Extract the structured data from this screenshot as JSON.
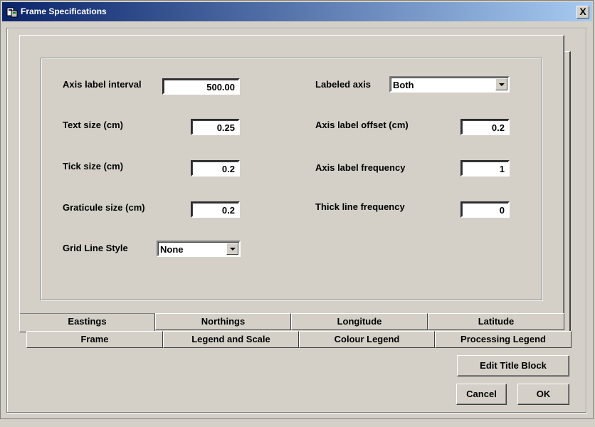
{
  "window": {
    "title": "Frame Specifications",
    "close_label": "X"
  },
  "form": {
    "axis_label_interval": {
      "label": "Axis label interval",
      "value": "500.00"
    },
    "text_size": {
      "label": "Text size (cm)",
      "value": "0.25"
    },
    "tick_size": {
      "label": "Tick size (cm)",
      "value": "0.2"
    },
    "graticule_size": {
      "label": "Graticule size (cm)",
      "value": "0.2"
    },
    "grid_line_style": {
      "label": "Grid Line Style",
      "value": "None"
    },
    "labeled_axis": {
      "label": "Labeled axis",
      "value": "Both"
    },
    "axis_label_offset": {
      "label": "Axis label offset (cm)",
      "value": "0.2"
    },
    "axis_label_frequency": {
      "label": "Axis label frequency",
      "value": "1"
    },
    "thick_line_frequency": {
      "label": "Thick line frequency",
      "value": "0"
    }
  },
  "tabs_front": [
    "Eastings",
    "Northings",
    "Longitude",
    "Latitude"
  ],
  "tabs_back": [
    "Frame",
    "Legend and Scale",
    "Colour Legend",
    "Processing Legend"
  ],
  "active_tab": "Eastings",
  "buttons": {
    "edit_title_block": "Edit Title Block",
    "cancel": "Cancel",
    "ok": "OK"
  }
}
